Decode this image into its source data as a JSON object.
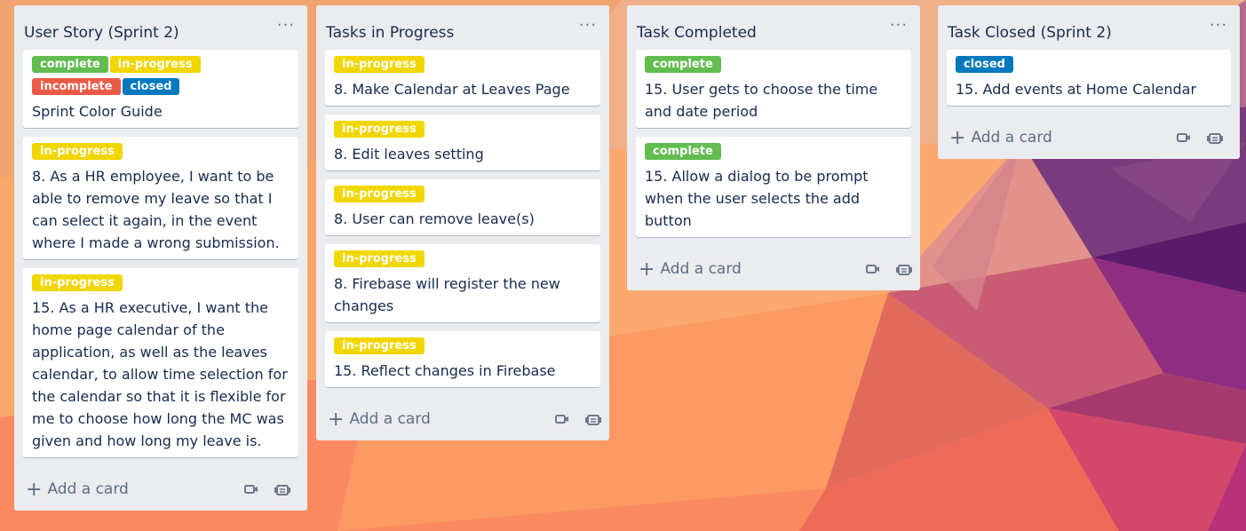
{
  "lists": [
    {
      "title": "User Story (Sprint 2)",
      "menu_icon": "more-horizontal-icon",
      "cards": [
        {
          "labels": [
            {
              "text": "complete",
              "color": "#61bd4f"
            },
            {
              "text": "in-progress",
              "color": "#f2d600"
            },
            {
              "text": "incomplete",
              "color": "#eb5a46"
            },
            {
              "text": "closed",
              "color": "#0079bf"
            }
          ],
          "text": "Sprint Color Guide"
        },
        {
          "labels": [
            {
              "text": "in-progress",
              "color": "#f2d600"
            }
          ],
          "text": "8. As a HR employee, I want to be able to remove my leave so that I can select it again, in the event where I made a wrong submission."
        },
        {
          "labels": [
            {
              "text": "in-progress",
              "color": "#f2d600"
            }
          ],
          "text": "15. As a HR executive, I want the home page calendar of the application, as well as the leaves calendar, to allow time selection for the calendar so that it is flexible for me to choose how long the MC was given and how long my leave is."
        }
      ],
      "add_card_label": "Add a card"
    },
    {
      "title": "Tasks in Progress",
      "menu_icon": "more-horizontal-icon",
      "cards": [
        {
          "labels": [
            {
              "text": "in-progress",
              "color": "#f2d600"
            }
          ],
          "text": "8. Make Calendar at Leaves Page"
        },
        {
          "labels": [
            {
              "text": "in-progress",
              "color": "#f2d600"
            }
          ],
          "text": "8. Edit leaves setting"
        },
        {
          "labels": [
            {
              "text": "in-progress",
              "color": "#f2d600"
            }
          ],
          "text": "8. User can remove leave(s)"
        },
        {
          "labels": [
            {
              "text": "in-progress",
              "color": "#f2d600"
            }
          ],
          "text": "8. Firebase will register the new changes"
        },
        {
          "labels": [
            {
              "text": "in-progress",
              "color": "#f2d600"
            }
          ],
          "text": "15. Reflect changes in Firebase"
        }
      ],
      "add_card_label": "Add a card"
    },
    {
      "title": "Task Completed",
      "menu_icon": "more-horizontal-icon",
      "cards": [
        {
          "labels": [
            {
              "text": "complete",
              "color": "#61bd4f"
            }
          ],
          "text": "15. User gets to choose the time and date period"
        },
        {
          "labels": [
            {
              "text": "complete",
              "color": "#61bd4f"
            }
          ],
          "text": "15. Allow a dialog to be prompt when the user selects the add button"
        }
      ],
      "add_card_label": "Add a card"
    },
    {
      "title": "Task Closed (Sprint 2)",
      "menu_icon": "more-horizontal-icon",
      "cards": [
        {
          "labels": [
            {
              "text": "closed",
              "color": "#0079bf"
            }
          ],
          "text": "15. Add events at Home Calendar"
        }
      ],
      "add_card_label": "Add a card"
    }
  ],
  "add_row_icons": [
    "video-camera-icon",
    "card-template-icon"
  ]
}
